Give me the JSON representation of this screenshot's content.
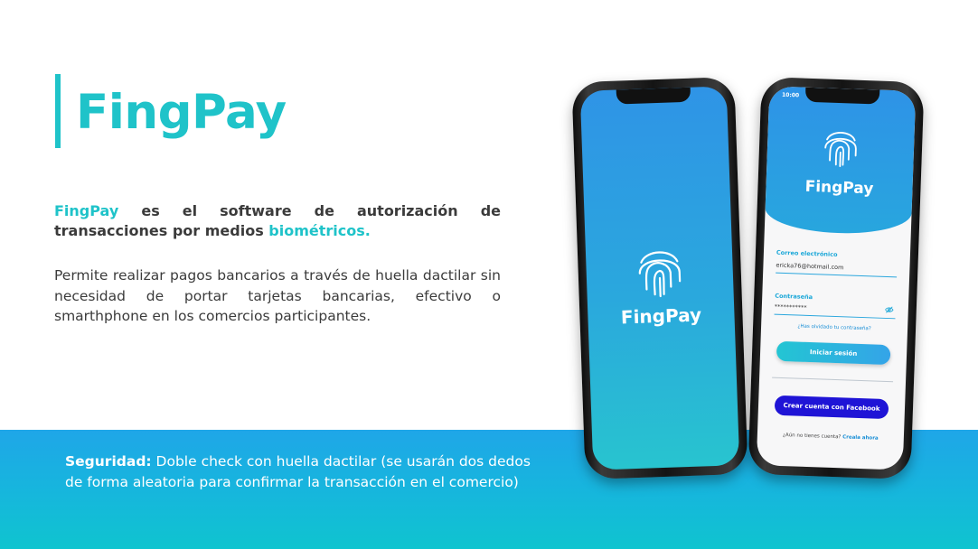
{
  "title": "FingPay",
  "intro": {
    "brand": "FingPay",
    "text_before": " es el software de autorización de transacciones por medios ",
    "highlight": "biométricos."
  },
  "description": "Permite realizar pagos bancarios a través de huella dactilar sin necesidad de portar tarjetas bancarias, efectivo o smarthphone en los comercios participantes.",
  "security": {
    "label": "Seguridad:",
    "text": " Doble check con huella dactilar (se usarán dos dedos de forma aleatoria para confirmar la transacción en el comercio)"
  },
  "phone_splash": {
    "app_name": "FingPay"
  },
  "phone_login": {
    "status_time": "10:00",
    "app_name": "FingPay",
    "email_label": "Correo electrónico",
    "email_value": "ericka76@hotmail.com",
    "password_label": "Contraseña",
    "password_value": "***********",
    "forgot_link": "¿Has olvidado tu contraseña?",
    "login_button": "Iniciar sesión",
    "facebook_button": "Crear cuenta con Facebook",
    "signup_prompt": "¿Aún no tienes cuenta?",
    "signup_link": "Creala ahora"
  },
  "colors": {
    "accent": "#1fc3c9",
    "text": "#3b3b3b",
    "band_top": "#1fa6e8",
    "band_bottom": "#0fc4cf",
    "facebook": "#1f14d6"
  },
  "icons": [
    "fingerprint-icon",
    "eye-off-icon"
  ]
}
